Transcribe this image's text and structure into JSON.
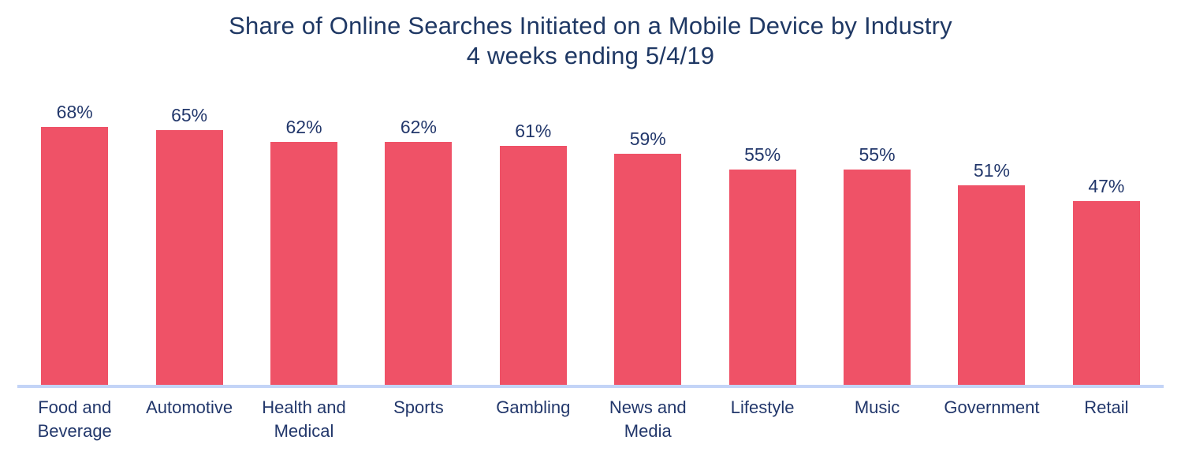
{
  "chart_data": {
    "type": "bar",
    "title": "Share of Online Searches Initiated on a Mobile Device by Industry\n4 weeks ending 5/4/19",
    "title_line1": "Share of Online Searches Initiated on a Mobile Device by Industry",
    "title_line2": "4 weeks ending 5/4/19",
    "xlabel": "",
    "ylabel": "",
    "ylim": [
      0,
      72
    ],
    "grid": false,
    "legend": "none",
    "axis_line_color": "#C3D4F7",
    "bar_color": "#EF5267",
    "text_color": "#22376B",
    "title_color": "#1F3864",
    "background_color": "#FFFFFF",
    "value_suffix": "%",
    "categories": [
      "Food and Beverage",
      "Automotive",
      "Health and Medical",
      "Sports",
      "Gambling",
      "News and Media",
      "Lifestyle",
      "Music",
      "Government",
      "Retail"
    ],
    "values": [
      68,
      65,
      62,
      62,
      61,
      59,
      55,
      55,
      51,
      47
    ],
    "value_labels": [
      "68%",
      "65%",
      "62%",
      "62%",
      "61%",
      "59%",
      "55%",
      "55%",
      "51%",
      "47%"
    ],
    "bars": [
      {
        "category": "Food and Beverage",
        "category_line1": "Food and",
        "category_line2": "Beverage",
        "value": 68,
        "label": "68%"
      },
      {
        "category": "Automotive",
        "category_line1": "Automotive",
        "category_line2": "",
        "value": 65,
        "label": "65%"
      },
      {
        "category": "Health and Medical",
        "category_line1": "Health and",
        "category_line2": "Medical",
        "value": 62,
        "label": "62%"
      },
      {
        "category": "Sports",
        "category_line1": "Sports",
        "category_line2": "",
        "value": 62,
        "label": "62%"
      },
      {
        "category": "Gambling",
        "category_line1": "Gambling",
        "category_line2": "",
        "value": 61,
        "label": "61%"
      },
      {
        "category": "News and Media",
        "category_line1": "News and",
        "category_line2": "Media",
        "value": 59,
        "label": "59%"
      },
      {
        "category": "Lifestyle",
        "category_line1": "Lifestyle",
        "category_line2": "",
        "value": 55,
        "label": "55%"
      },
      {
        "category": "Music",
        "category_line1": "Music",
        "category_line2": "",
        "value": 55,
        "label": "55%"
      },
      {
        "category": "Government",
        "category_line1": "Government",
        "category_line2": "",
        "value": 51,
        "label": "51%"
      },
      {
        "category": "Retail",
        "category_line1": "Retail",
        "category_line2": "",
        "value": 47,
        "label": "47%"
      }
    ]
  }
}
